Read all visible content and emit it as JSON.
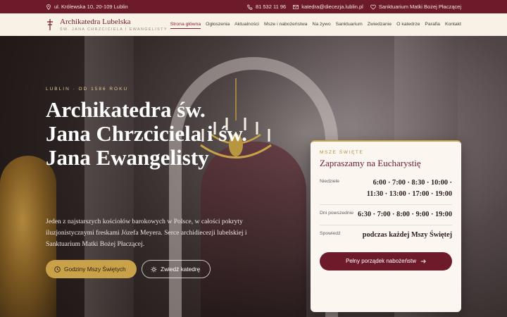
{
  "topbar": {
    "address": "ul. Królewska 10, 20-109 Lublin",
    "phone": "81 532 11 96",
    "email": "katedra@diecezja.lublin.pl",
    "sanctuary": "Sanktuarium Matki Bożej Płaczącej"
  },
  "logo": {
    "title": "Archikatedra Lubelska",
    "subtitle": "ŚW. JANA CHRZCICIELA I EWANGELISTY"
  },
  "menu": [
    "Strona główna",
    "Ogłoszenia",
    "Aktualności",
    "Msze i nabożeństwa",
    "Na żywo",
    "Sanktuarium",
    "Zwiedzanie",
    "O katedrze",
    "Parafia",
    "Kontakt"
  ],
  "hero": {
    "eyebrow": "LUBLIN · OD 1586 ROKU",
    "title": "Archikatedra św. Jana Chrzciciela i św. Jana Ewangelisty",
    "lead": "Jeden z najstarszych kościołów barokowych w Polsce, w całości pokryty iluzjonistycznymi freskami Józefa Meyera. Serce archidiecezji lubelskiej i Sanktuarium Matki Bożej Płaczącej.",
    "primary_button": "Godziny Mszy Świętych",
    "secondary_button": "Zwiedź katedrę"
  },
  "mass_card": {
    "kicker": "MSZE ŚWIĘTE",
    "title": "Zapraszamy na Eucharystię",
    "rows": [
      {
        "label": "Niedziele",
        "value": "6:00 · 7:00 · 8:30 · 10:00 · 11:30 · 13:00 · 17:00 · 19:00"
      },
      {
        "label": "Dni powszednie",
        "value": "6:30 · 7:00 · 8:00 · 9:00 · 19:00"
      },
      {
        "label": "Spowiedź",
        "value": "podczas każdej Mszy Świętej"
      }
    ],
    "cta": "Pełny porządek nabożeństw"
  },
  "colors": {
    "burgundy": "#6d1a2a",
    "gold": "#c9a149",
    "cream": "#f7f1e6"
  }
}
